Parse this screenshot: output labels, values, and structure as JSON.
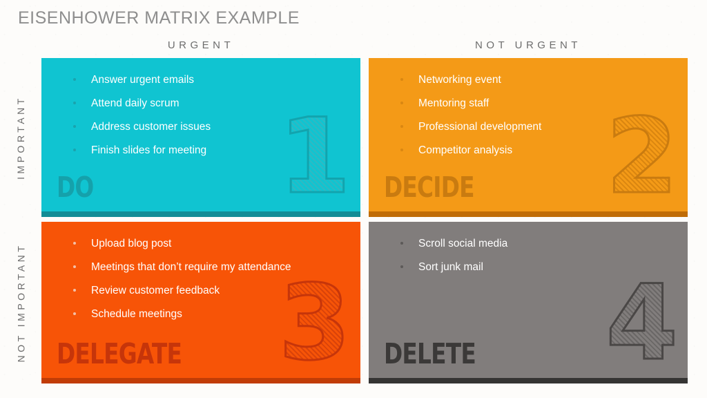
{
  "slide": {
    "title": "EISENHOWER MATRIX EXAMPLE",
    "background_color": "#fdfcfa",
    "title_color": "#8e8e8e"
  },
  "axes": {
    "columns": [
      {
        "label": "URGENT"
      },
      {
        "label": "NOT URGENT"
      }
    ],
    "rows": [
      {
        "label": "IMPORTANT"
      },
      {
        "label": "NOT IMPORTANT"
      }
    ]
  },
  "quadrants": [
    {
      "id": "q1",
      "number": "1",
      "action": "DO",
      "urgency": "URGENT",
      "importance": "IMPORTANT",
      "fill_color": "#10c4d1",
      "accent_color": "#128c95",
      "tasks": [
        "Answer urgent emails",
        "Attend daily scrum",
        "Address customer issues",
        "Finish slides for meeting"
      ]
    },
    {
      "id": "q2",
      "number": "2",
      "action": "DECIDE",
      "urgency": "NOT URGENT",
      "importance": "IMPORTANT",
      "fill_color": "#f49a17",
      "accent_color": "#c06c06",
      "tasks": [
        "Networking event",
        "Mentoring staff",
        "Professional development",
        "Competitor analysis"
      ]
    },
    {
      "id": "q3",
      "number": "3",
      "action": "DELEGATE",
      "urgency": "URGENT",
      "importance": "NOT IMPORTANT",
      "fill_color": "#f75407",
      "accent_color": "#c13c06",
      "tasks": [
        "Upload blog post",
        "Meetings that don’t require my attendance",
        "Review customer feedback",
        "Schedule meetings"
      ]
    },
    {
      "id": "q4",
      "number": "4",
      "action": "DELETE",
      "urgency": "NOT URGENT",
      "importance": "NOT IMPORTANT",
      "fill_color": "#817d7c",
      "accent_color": "#353433",
      "tasks": [
        "Scroll social media",
        "Sort junk mail"
      ]
    }
  ]
}
